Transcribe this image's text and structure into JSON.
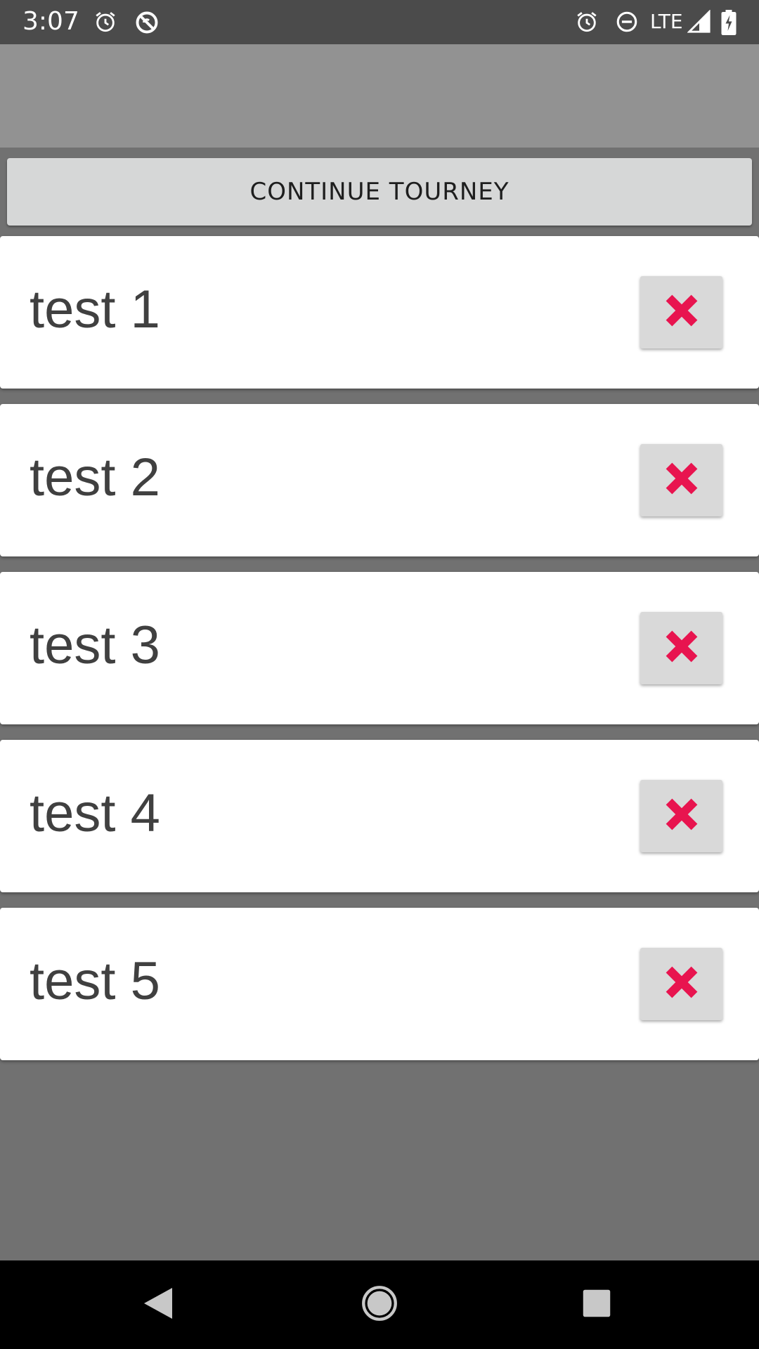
{
  "status_bar": {
    "time": "3:07",
    "network": "LTE",
    "icons": [
      "alarm-icon",
      "no-sync-icon",
      "alarm-icon",
      "do-not-disturb-icon",
      "signal-icon",
      "battery-charging-icon"
    ]
  },
  "toolbar": {
    "title": ""
  },
  "continue_button": {
    "label": "CONTINUE TOURNEY"
  },
  "players": [
    {
      "name": "test 1",
      "delete_icon": "close-icon"
    },
    {
      "name": "test 2",
      "delete_icon": "close-icon"
    },
    {
      "name": "test 3",
      "delete_icon": "close-icon"
    },
    {
      "name": "test 4",
      "delete_icon": "close-icon"
    },
    {
      "name": "test 5",
      "delete_icon": "close-icon"
    }
  ],
  "navigation": {
    "buttons": [
      "back-icon",
      "home-icon",
      "recents-icon"
    ]
  },
  "colors": {
    "delete_x": "#e8144f",
    "background": "#717171",
    "toolbar": "#929292",
    "status_bar": "#4b4b4b"
  }
}
